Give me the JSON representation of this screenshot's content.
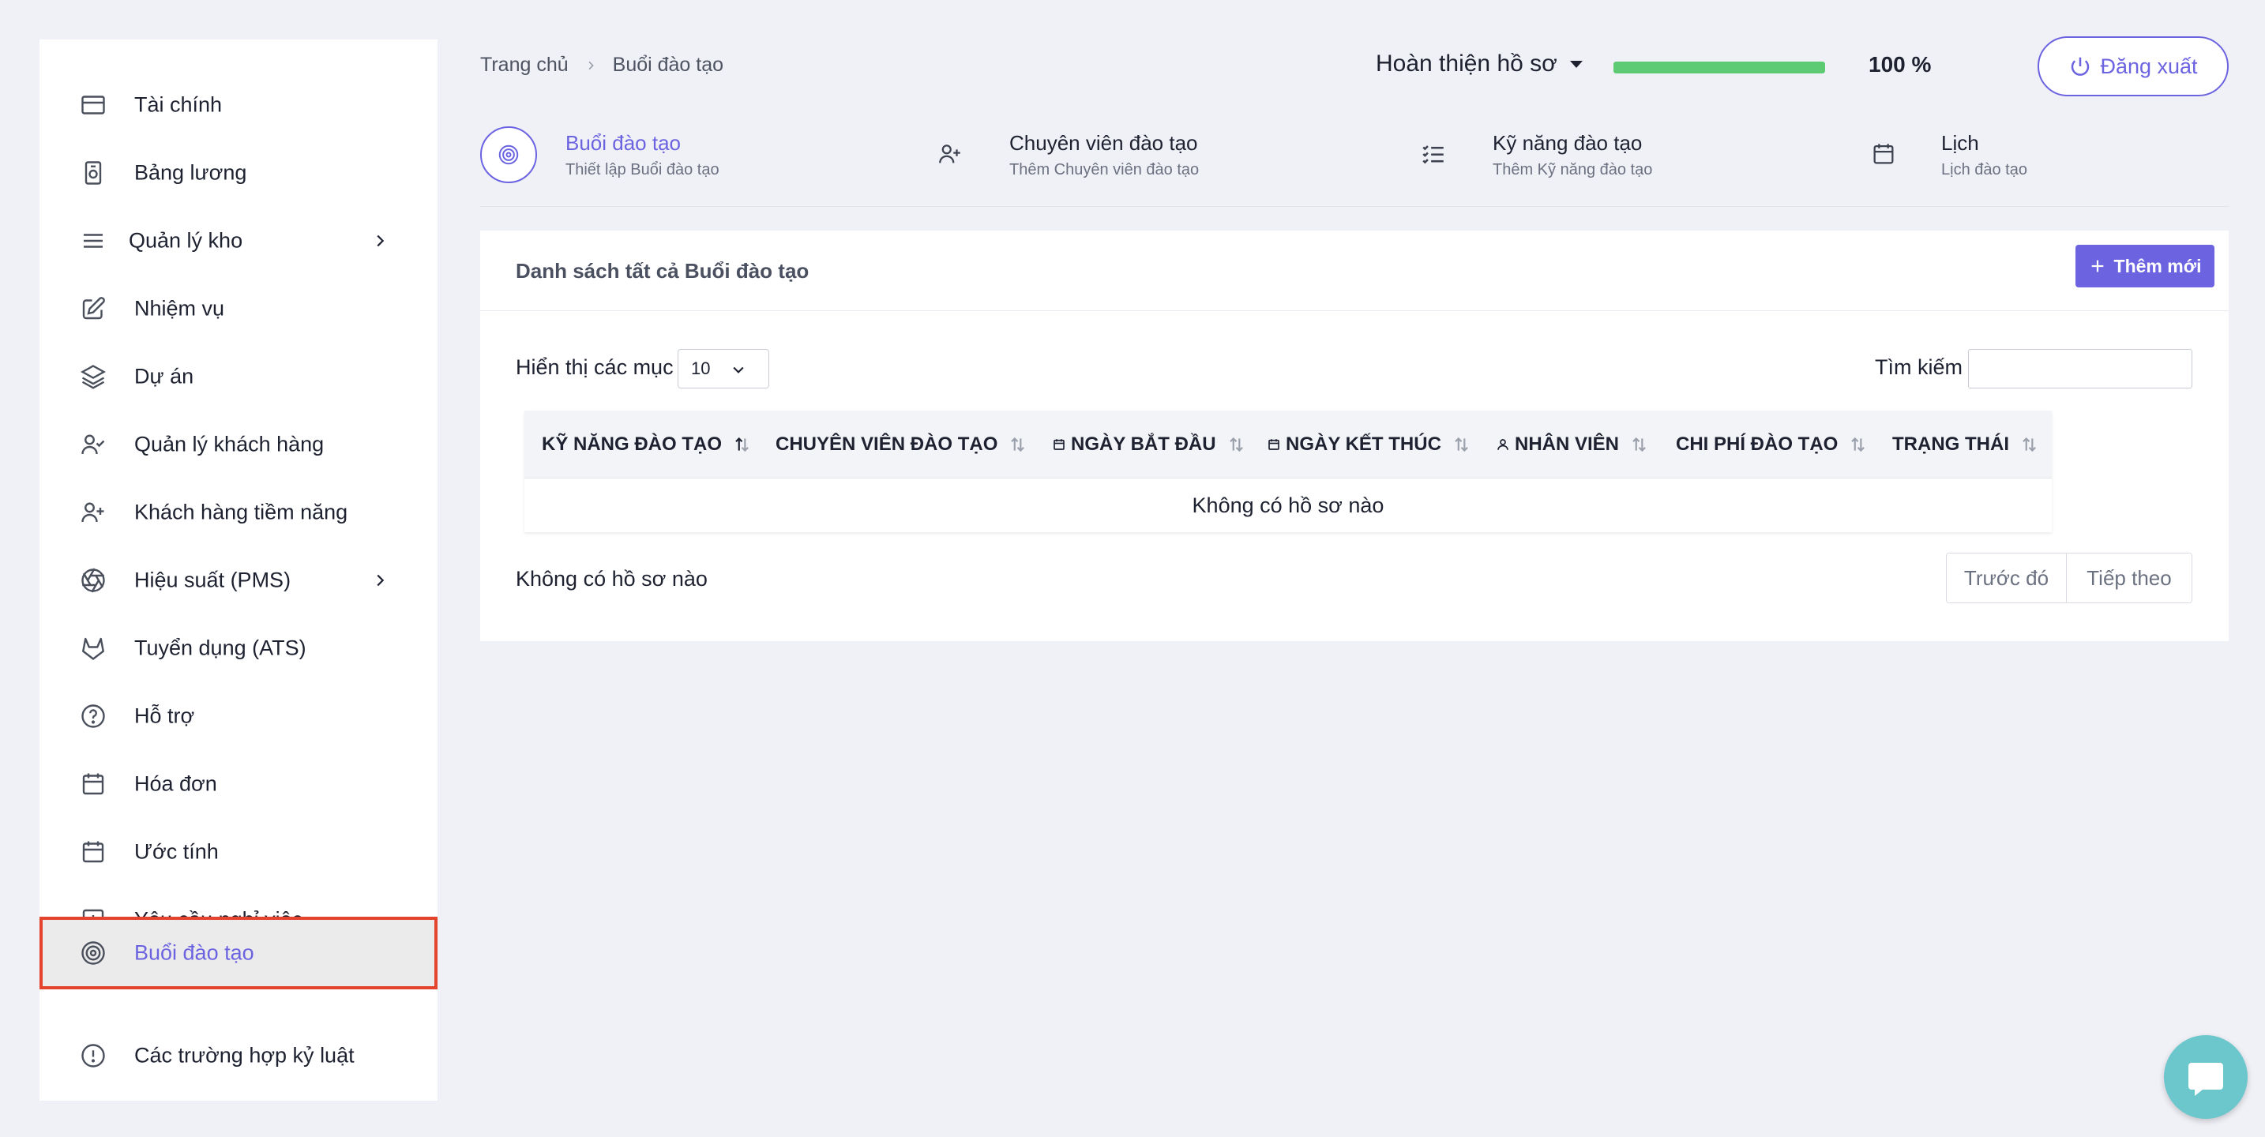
{
  "sidebar": {
    "items": [
      {
        "label": "Tài chính",
        "icon": "credit-card-icon"
      },
      {
        "label": "Bảng lương",
        "icon": "payroll-icon"
      },
      {
        "label": "Quản lý kho",
        "icon": "menu-lines-icon"
      },
      {
        "label": "Nhiệm vụ",
        "icon": "edit-icon"
      },
      {
        "label": "Dự án",
        "icon": "layers-icon"
      },
      {
        "label": "Quản lý khách hàng",
        "icon": "user-check-icon"
      },
      {
        "label": "Khách hàng tiềm năng",
        "icon": "user-plus-icon"
      },
      {
        "label": "Hiệu suất (PMS)",
        "icon": "aperture-icon"
      },
      {
        "label": "Tuyển dụng (ATS)",
        "icon": "gitlab-icon"
      },
      {
        "label": "Hỗ trợ",
        "icon": "help-circle-icon"
      },
      {
        "label": "Hóa đơn",
        "icon": "calendar-icon"
      },
      {
        "label": "Ước tính",
        "icon": "calendar-icon"
      },
      {
        "label": "Yêu cầu nghỉ việc",
        "icon": "plus-square-icon"
      },
      {
        "label": "Buổi đào tạo",
        "icon": "target-icon",
        "active": true
      },
      {
        "label": "Các trường hợp kỷ luật",
        "icon": "alert-circle-icon"
      }
    ]
  },
  "topbar": {
    "breadcrumb_home": "Trang chủ",
    "breadcrumb_current": "Buổi đào tạo",
    "profile_label": "Hoàn thiện hồ sơ",
    "progress_percent": 100,
    "progress_text": "100 %",
    "progress_color": "#5ccb73",
    "logout_label": "Đăng xuất"
  },
  "steps": [
    {
      "title": "Buổi đào tạo",
      "subtitle": "Thiết lập Buổi đào tạo",
      "icon": "target-icon"
    },
    {
      "title": "Chuyên viên đào tạo",
      "subtitle": "Thêm Chuyên viên đào tạo",
      "icon": "user-plus-icon"
    },
    {
      "title": "Kỹ năng đào tạo",
      "subtitle": "Thêm Kỹ năng đào tạo",
      "icon": "list-check-icon"
    },
    {
      "title": "Lịch",
      "subtitle": "Lịch đào tạo",
      "icon": "calendar-icon"
    }
  ],
  "card": {
    "title": "Danh sách tất cả Buổi đào tạo",
    "add_label": "Thêm mới",
    "show_label": "Hiển thị các mục",
    "page_size": "10",
    "search_label": "Tìm kiếm",
    "search_value": "",
    "columns": [
      "KỸ NĂNG ĐÀO TẠO",
      "CHUYÊN VIÊN ĐÀO TẠO",
      "NGÀY BẮT ĐẦU",
      "NGÀY KẾT THÚC",
      "NHÂN VIÊN",
      "CHI PHÍ ĐÀO TẠO",
      "TRẠNG THÁI"
    ],
    "empty_text": "Không có hồ sơ nào",
    "info_text": "Không có hồ sơ nào",
    "prev_label": "Trước đó",
    "next_label": "Tiếp theo"
  },
  "colors": {
    "accent": "#6b63e0",
    "highlight_border": "#e4432d",
    "chat_bubble": "#6cc7cd"
  }
}
